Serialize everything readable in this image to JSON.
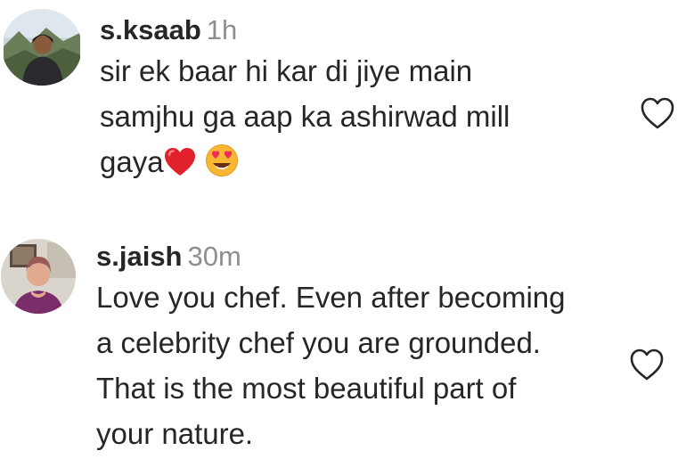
{
  "comments": [
    {
      "username": "s.ksaab",
      "time": "1h",
      "lines": [
        "sir ek baar hi kar di jiye main",
        "samjhu ga aap ka ashirwad mill",
        "gaya"
      ],
      "emojis": [
        "red-heart-emoji",
        "heart-eyes-emoji"
      ],
      "avatar_icon": "user-avatar",
      "like_icon": "heart-outline-icon"
    },
    {
      "username": "s.jaish",
      "time": "30m",
      "lines": [
        "Love you chef. Even after becoming",
        "a celebrity chef you are grounded.",
        "That is the most beautiful part of",
        "your nature."
      ],
      "avatar_icon": "user-avatar",
      "like_icon": "heart-outline-icon"
    }
  ],
  "colors": {
    "text": "#262626",
    "secondary": "#8e8e8e",
    "heart_emoji": "#e0202c",
    "face_emoji": "#f7b733"
  }
}
